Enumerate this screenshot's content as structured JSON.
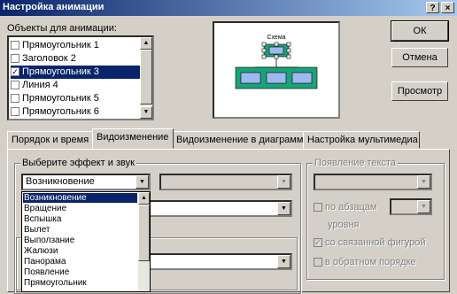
{
  "window": {
    "title": "Настройка анимации",
    "help_glyph": "?",
    "close_glyph": "×"
  },
  "objects": {
    "label": "Объекты для анимации:",
    "items": [
      {
        "label": "Прямоугольник 1",
        "checked": false
      },
      {
        "label": "Заголовок 2",
        "checked": false
      },
      {
        "label": "Прямоугольник 3",
        "checked": true
      },
      {
        "label": "Линия 4",
        "checked": false
      },
      {
        "label": "Прямоугольник 5",
        "checked": false
      },
      {
        "label": "Прямоугольник 6",
        "checked": false
      }
    ]
  },
  "preview": {
    "caption": "Схема"
  },
  "buttons": {
    "ok": "ОК",
    "cancel": "Отмена",
    "preview": "Просмотр"
  },
  "tabs": [
    "Порядок и время",
    "Видоизменение",
    "Видоизменение в диаграмме",
    "Настройка мультимедиа"
  ],
  "effect_group": {
    "title": "Выберите эффект и звук",
    "effect_value": "Возникновение"
  },
  "text_group": {
    "title": "Появление текста",
    "by_level": "по абзацам",
    "level_word": "уровня",
    "with_shape": "со связанной фигурой",
    "reverse": "в обратном порядке"
  },
  "dropdown_options": [
    "Возникновение",
    "Вращение",
    "Вспышка",
    "Вылет",
    "Выползание",
    "Жалюзи",
    "Панорама",
    "Появление",
    "Прямоугольник"
  ],
  "colors": {
    "selection": "#0a246a",
    "title_start": "#0a246a",
    "title_end": "#a6caf0",
    "shape_green": "#1aa37a",
    "shape_blue": "#9fb9f0"
  }
}
